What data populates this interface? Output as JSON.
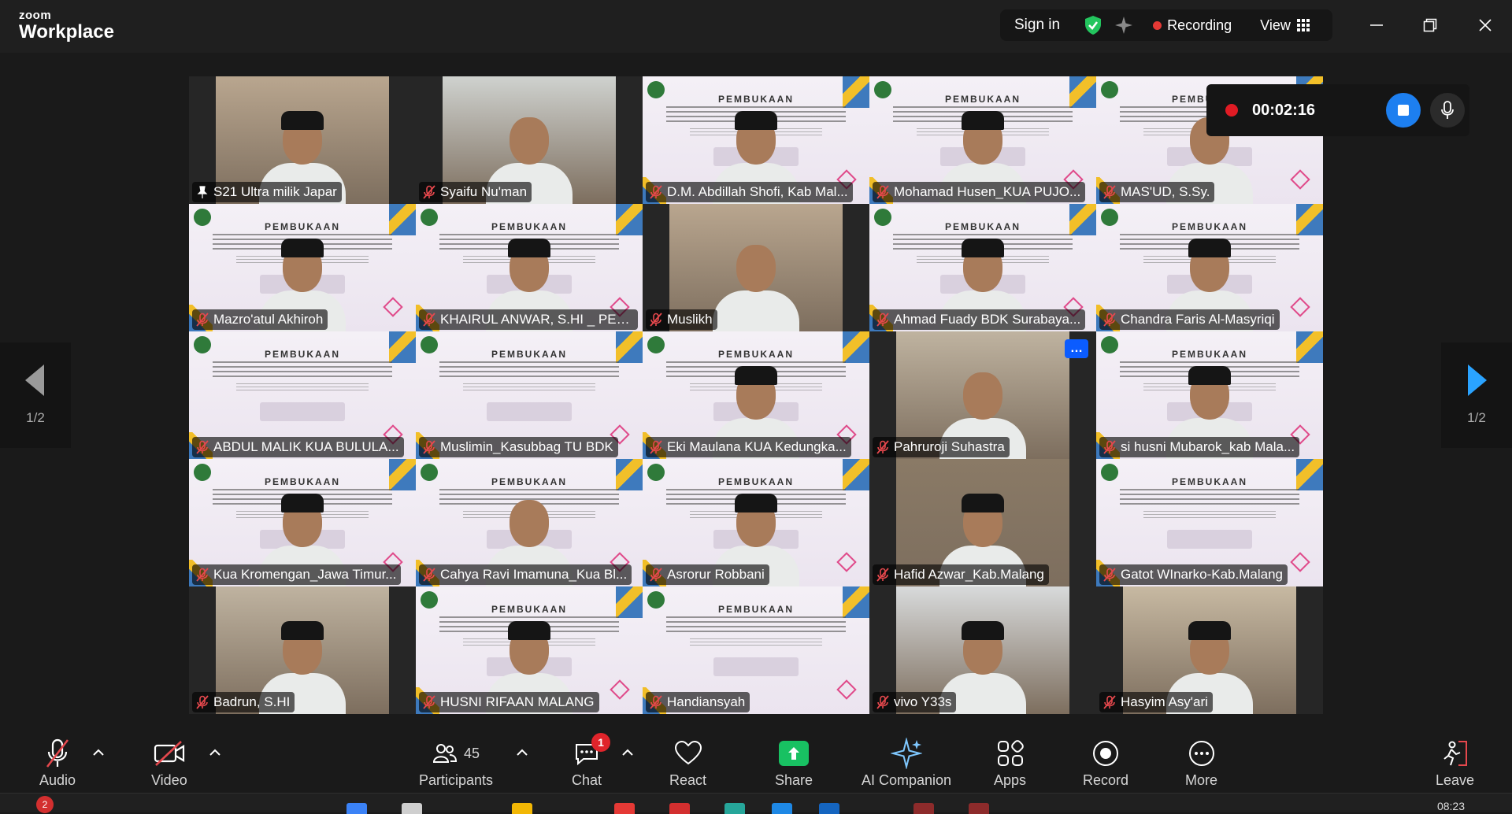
{
  "app": {
    "brand_top": "zoom",
    "brand_bottom": "Workplace"
  },
  "topbar": {
    "sign_in": "Sign in",
    "recording": "Recording",
    "view": "View"
  },
  "recording_panel": {
    "timer": "00:02:16"
  },
  "pagination": {
    "left": "1/2",
    "right": "1/2"
  },
  "participants": [
    {
      "name": "S21 Ultra milik Japar",
      "kind": "photo",
      "pinned": true,
      "active": true
    },
    {
      "name": "Syaifu Nu'man",
      "kind": "photo"
    },
    {
      "name": "D.M. Abdillah Shofi, Kab Mal...",
      "kind": "banner",
      "person": true
    },
    {
      "name": "Mohamad Husen_KUA PUJO...",
      "kind": "banner",
      "person": true
    },
    {
      "name": "MAS'UD, S.Sy.",
      "kind": "banner",
      "person": true
    },
    {
      "name": "Mazro'atul Akhiroh",
      "kind": "banner",
      "person": true
    },
    {
      "name": "KHAIRUL ANWAR, S.HI _ PEN...",
      "kind": "banner",
      "person": true
    },
    {
      "name": "Muslikh",
      "kind": "photo"
    },
    {
      "name": "Ahmad Fuady BDK Surabaya...",
      "kind": "banner",
      "person": true
    },
    {
      "name": "Chandra Faris Al-Masyriqi",
      "kind": "banner",
      "person": true
    },
    {
      "name": "ABDUL MALIK KUA BULULA...",
      "kind": "banner"
    },
    {
      "name": "Muslimin_Kasubbag TU BDK",
      "kind": "banner"
    },
    {
      "name": "Eki Maulana KUA Kedungka...",
      "kind": "banner",
      "person": true
    },
    {
      "name": "Pahruroji Suhastra",
      "kind": "photo",
      "more": true
    },
    {
      "name": "si husni Mubarok_kab Mala...",
      "kind": "banner",
      "person": true
    },
    {
      "name": "Kua Kromengan_Jawa Timur...",
      "kind": "banner",
      "person": true
    },
    {
      "name": "Cahya Ravi Imamuna_Kua Bl...",
      "kind": "banner",
      "person": true
    },
    {
      "name": "Asrorur Robbani",
      "kind": "banner",
      "person": true
    },
    {
      "name": "Hafid Azwar_Kab.Malang",
      "kind": "photo"
    },
    {
      "name": "Gatot WInarko-Kab.Malang",
      "kind": "banner"
    },
    {
      "name": "Badrun, S.HI",
      "kind": "photo"
    },
    {
      "name": "HUSNI RIFAAN MALANG",
      "kind": "banner",
      "person": true
    },
    {
      "name": "Handiansyah",
      "kind": "banner"
    },
    {
      "name": "vivo Y33s",
      "kind": "photo"
    },
    {
      "name": "Hasyim Asy'ari",
      "kind": "photo"
    }
  ],
  "banner_text": "PEMBUKAAN",
  "more_button": "…",
  "toolbar": {
    "audio": "Audio",
    "video": "Video",
    "participants": "Participants",
    "participants_count": "45",
    "chat": "Chat",
    "chat_badge": "1",
    "react": "React",
    "share": "Share",
    "ai_companion": "AI Companion",
    "apps": "Apps",
    "record": "Record",
    "more": "More",
    "leave": "Leave"
  },
  "taskbar": {
    "badge": "2",
    "clock": "08:23"
  },
  "colors": {
    "active_border": "#23d18b",
    "accent_blue": "#0b5cff",
    "record_red": "#e01b24",
    "share_green": "#18c162"
  }
}
